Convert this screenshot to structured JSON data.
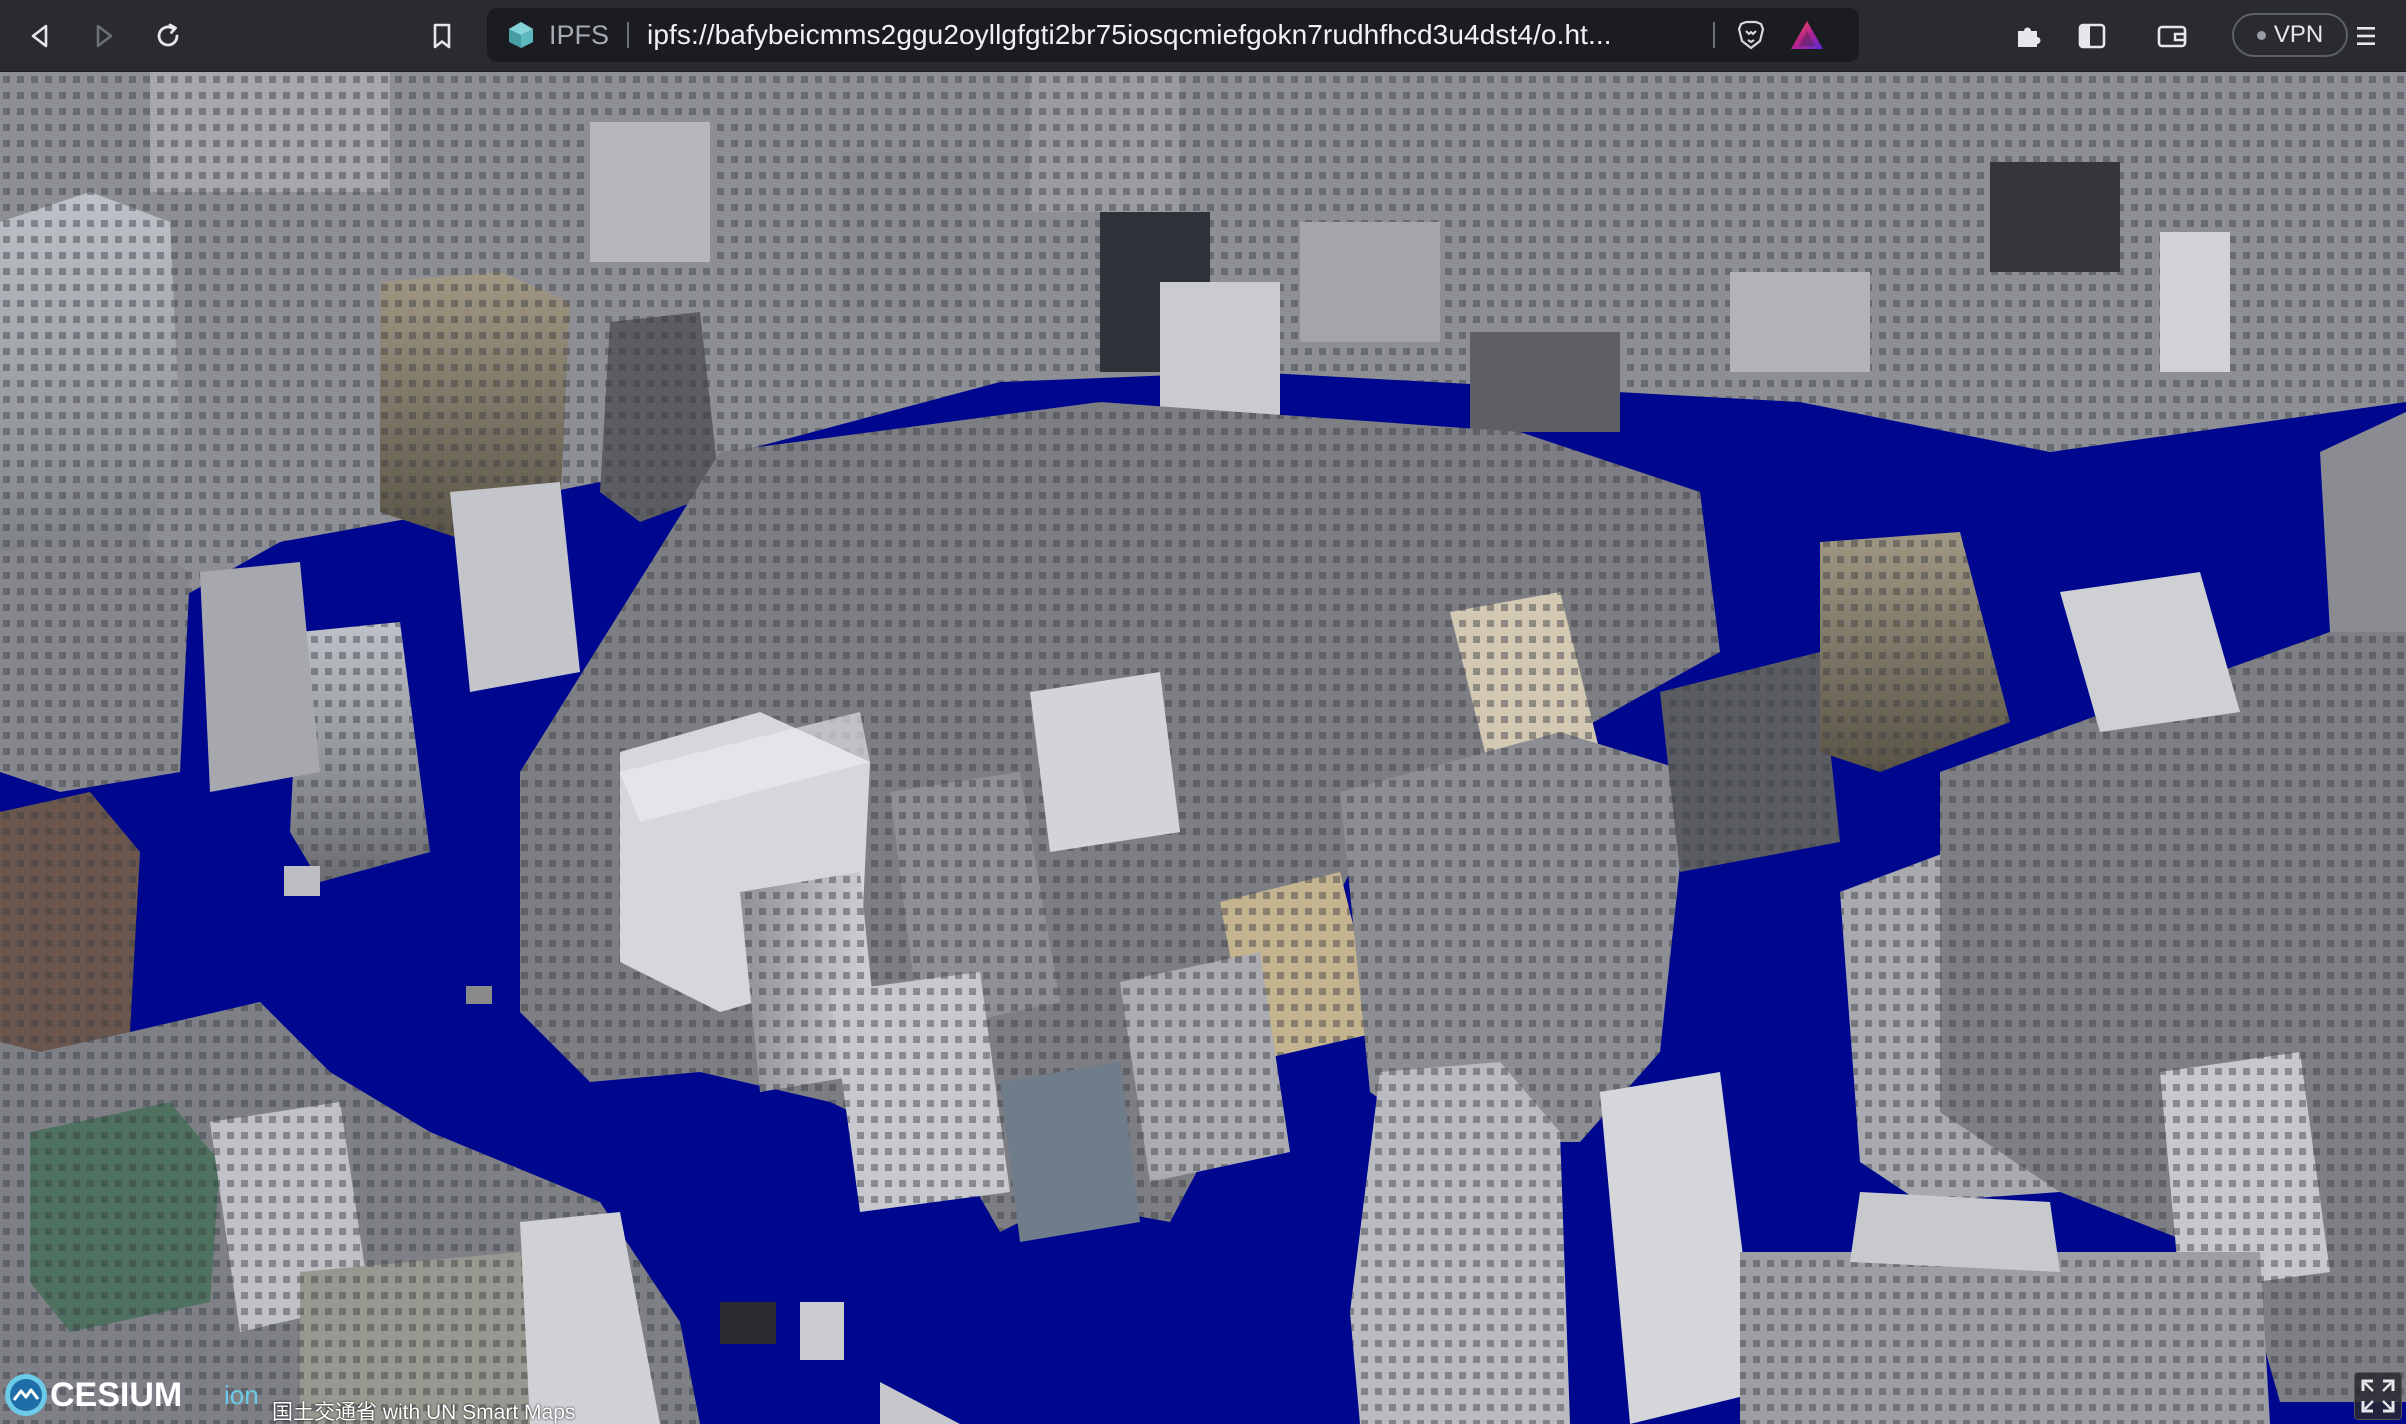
{
  "browser": {
    "toolbar": {
      "back_icon": "back-icon",
      "forward_icon": "forward-icon",
      "reload_icon": "reload-icon",
      "bookmark_icon": "bookmark-icon",
      "extensions_icon": "puzzle-icon",
      "sidebar_icon": "sidebar-icon",
      "wallet_icon": "wallet-icon",
      "menu_icon": "hamburger-menu-icon"
    },
    "omnibox": {
      "scheme_label": "IPFS",
      "url": "ipfs://bafybeicmms2ggu2oyllgfgti2br75iosqcmiefgokn7rudhfhcd3u4dst4/o.ht...",
      "brave_shields_icon": "brave-lion-icon",
      "rewards_icon": "rewards-triangle-icon"
    },
    "vpn": {
      "label": "VPN",
      "status": "off"
    }
  },
  "viewer": {
    "logo_text": "CESIUM",
    "logo_suffix": "ion",
    "attribution": "国土交通省 with UN Smart Maps",
    "fullscreen_icon": "fullscreen-icon"
  },
  "colors": {
    "toolbar_bg": "#2a2b31",
    "omnibox_bg": "#1b1c21",
    "ground": "#00078f",
    "accent_ipfs": "#65c2cb"
  }
}
